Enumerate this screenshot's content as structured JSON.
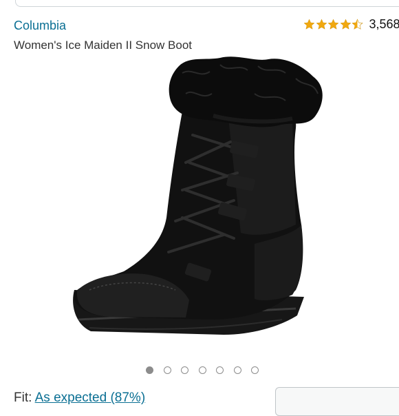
{
  "product": {
    "brand": "Columbia",
    "title": "Women's Ice Maiden II Snow Boot",
    "rating": {
      "stars": 4.5,
      "count": "3,568"
    }
  },
  "gallery": {
    "image_count": 7,
    "active_index": 0,
    "image_icon": "black-snow-boot-photo"
  },
  "fit": {
    "label": "Fit:",
    "value": "As expected (87%)"
  },
  "colors": {
    "link": "#0a6f93",
    "star": "#f1a80f",
    "dot": "#8c8c8c"
  }
}
